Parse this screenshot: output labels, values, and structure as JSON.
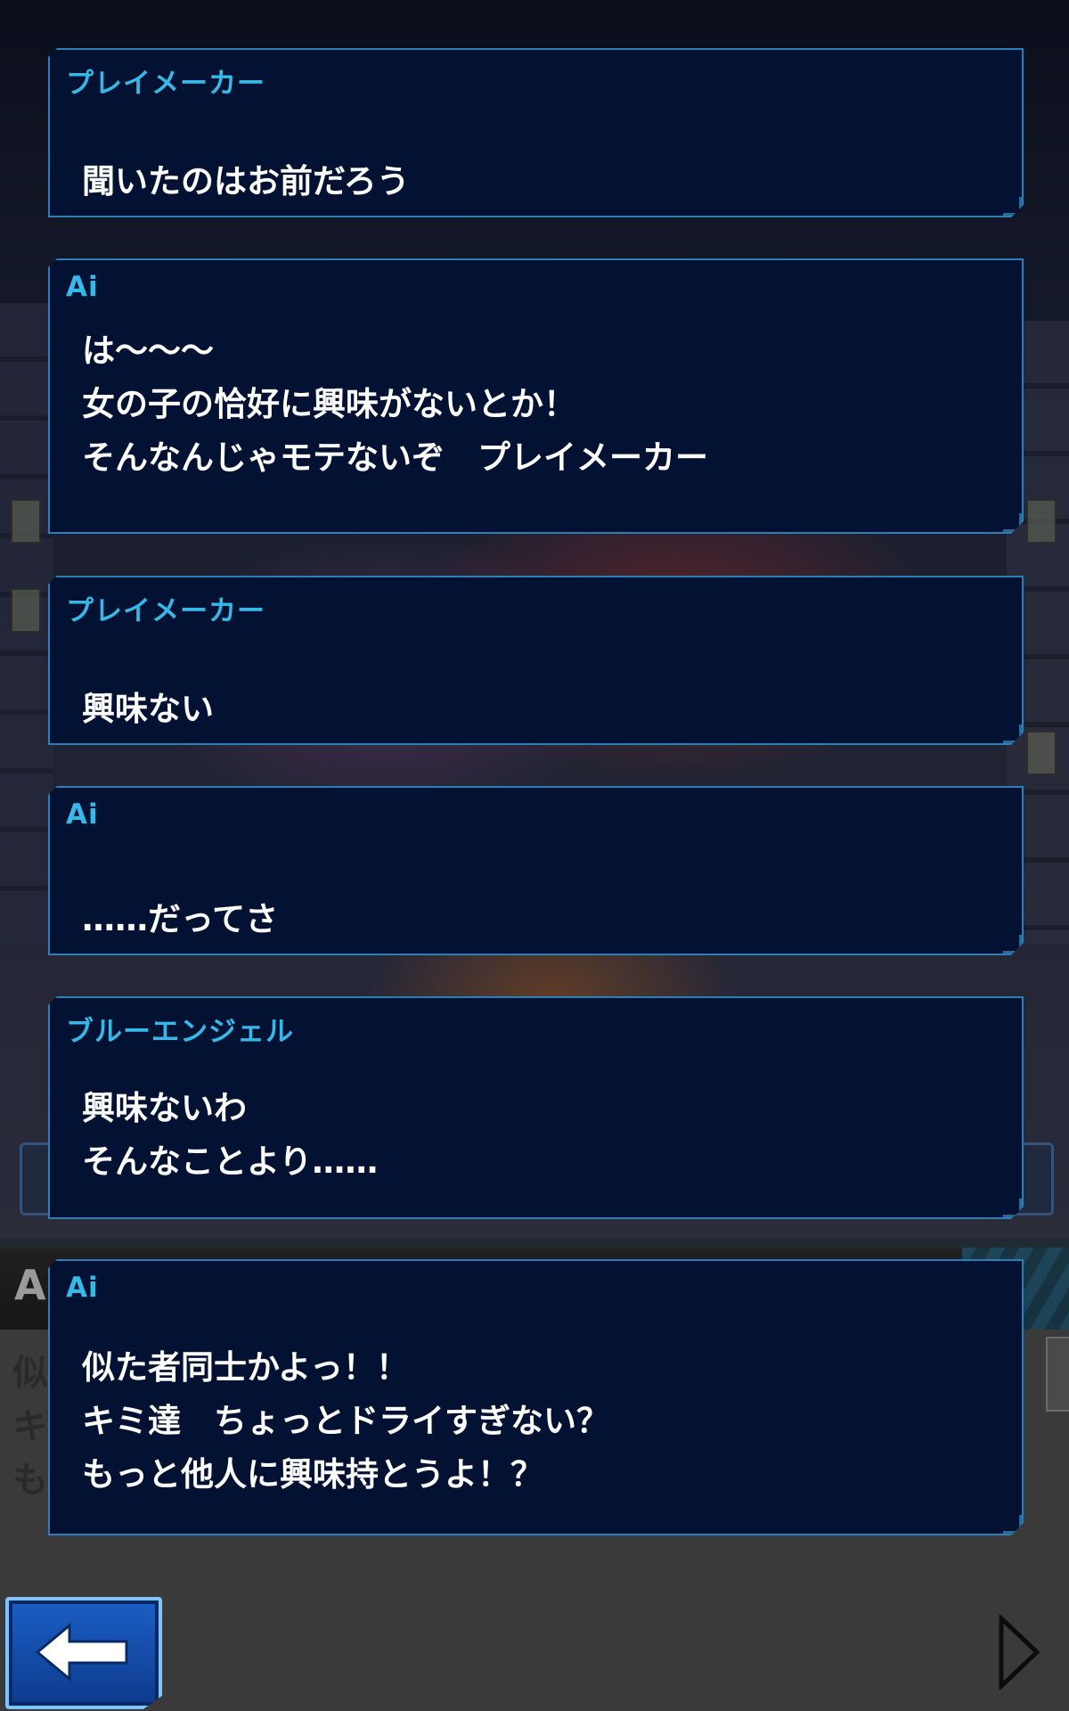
{
  "log": [
    {
      "speaker": "プレイメーカー",
      "lines": [
        "聞いたのはお前だろう"
      ]
    },
    {
      "speaker": "Ai",
      "lines": [
        "は～～～",
        "女の子の恰好に興味がないとか！",
        "そんなんじゃモテないぞ　プレイメーカー"
      ]
    },
    {
      "speaker": "プレイメーカー",
      "lines": [
        "興味ない"
      ]
    },
    {
      "speaker": "Ai",
      "lines": [
        "……だってさ"
      ]
    },
    {
      "speaker": "ブルーエンジェル",
      "lines": [
        "興味ないわ",
        "そんなことより……"
      ]
    },
    {
      "speaker": "Ai",
      "lines": [
        "似た者同士かよっ！！",
        "キミ達　ちょっとドライすぎない？",
        "もっと他人に興味持とうよ！？"
      ]
    }
  ],
  "underlying": {
    "name_fragment": "A",
    "text_fragments": [
      "似",
      "キ",
      "も"
    ]
  },
  "controls": {
    "back_icon": "back-arrow-icon",
    "next_icon": "next-triangle-icon"
  },
  "colors": {
    "speaker_name": "#36b9e6",
    "entry_background": "#031232",
    "entry_border": "#2b7fb6",
    "text": "#ffffff",
    "back_button": "#1a5fc4"
  }
}
